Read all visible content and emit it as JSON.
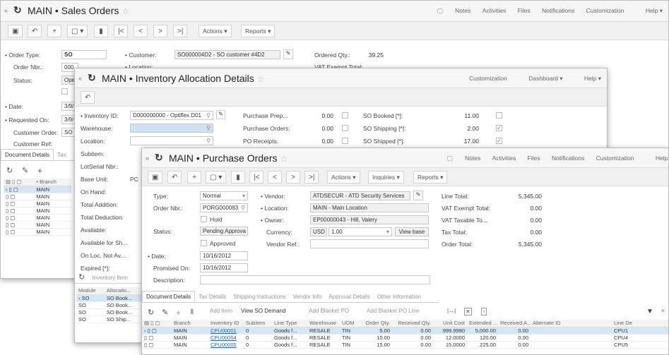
{
  "so": {
    "ref": "MAIN",
    "title": "Sales Orders",
    "header_links": [
      "Notes",
      "Activities",
      "Files",
      "Notifications",
      "Customization",
      "Help"
    ],
    "toolbar": {
      "actions": "Actions",
      "reports": "Reports"
    },
    "order_type_label": "• Order Type:",
    "order_type": "SO",
    "order_nbr_label": "Order Nbr.:",
    "order_nbr": "000",
    "status_label": "Status:",
    "status": "Ope",
    "date_label": "• Date:",
    "date": "3/9/",
    "requested_label": "• Requested On:",
    "requested": "3/9/",
    "customer_order_label": "Customer Order:",
    "customer_order": "SO",
    "customer_ref_label": "Customer Ref:",
    "customer_label": "• Customer:",
    "customer": "SO000004D2 - SO customer #4D2",
    "location_label": "• Location:",
    "ordered_qty_label": "Ordered Qty.:",
    "ordered_qty": "39.25",
    "vat_exempt_label": "VAT Exempt Total:",
    "tabs": [
      "Document Details",
      "Tax"
    ],
    "grid_header": "Branch",
    "grid_rows": [
      "MAIN",
      "MAIN",
      "MAIN",
      "MAIN",
      "MAIN",
      "MAIN",
      "MAIN"
    ]
  },
  "ia": {
    "ref": "MAIN",
    "title": "Inventory Allocation Details",
    "header_links": [
      "Customization",
      "Dashboard",
      "Help"
    ],
    "fields": [
      {
        "label": "• Inventory ID:",
        "value": "D000000000 - Optiflex D01"
      },
      {
        "label": "Warehouse:",
        "value": ""
      },
      {
        "label": "Location:",
        "value": ""
      },
      {
        "label": "Subitem:",
        "value": ""
      },
      {
        "label": "LotSerial Nbr.:",
        "value": ""
      },
      {
        "label": "Base Unit:",
        "value": "PC"
      },
      {
        "label": "On Hand:",
        "value": ""
      },
      {
        "label": "Total Addition:",
        "value": ""
      },
      {
        "label": "Total Deduction:",
        "value": ""
      },
      {
        "label": "Available:",
        "value": ""
      },
      {
        "label": "Available for Sh...",
        "value": ""
      },
      {
        "label": "On Loc. Not Av...",
        "value": ""
      },
      {
        "label": "Expired [*]:",
        "value": ""
      }
    ],
    "mid": [
      {
        "label": "Purchase Prep...",
        "value": "0.00"
      },
      {
        "label": "Purchase Orders:",
        "value": "0.00"
      },
      {
        "label": "PO Receipts:",
        "value": "0.00"
      }
    ],
    "right": [
      {
        "label": "SO Booked [*]:",
        "value": "11.00",
        "checked": false
      },
      {
        "label": "SO Shipping [*]:",
        "value": "2.00",
        "checked": true
      },
      {
        "label": "SO Shipped [*]:",
        "value": "17.00",
        "checked": true
      }
    ],
    "grid_tab": "Inventory Item",
    "grid_cols": [
      "Module",
      "Allocatio..."
    ],
    "grid_rows": [
      [
        "SO",
        "SO Book..."
      ],
      [
        "SO",
        "SO Book..."
      ],
      [
        "SO",
        "SO Book..."
      ],
      [
        "SO",
        "SO Ship..."
      ]
    ]
  },
  "po": {
    "ref": "MAIN",
    "title": "Purchase Orders",
    "header_links": [
      "Notes",
      "Activities",
      "Files",
      "Notifications",
      "Customization",
      "Help"
    ],
    "toolbar": {
      "actions": "Actions",
      "inquiries": "Inquiries",
      "reports": "Reports"
    },
    "type_label": "Type:",
    "type": "Normal",
    "order_nbr_label": "Order Nbr.:",
    "order_nbr": "PORG000083",
    "hold_label": "Hold",
    "status_label": "Status:",
    "status": "Pending Approva",
    "approved_label": "Approved",
    "date_label": "• Date:",
    "date": "10/16/2012",
    "promised_label": "Promised On:",
    "promised": "10/16/2012",
    "description_label": "Description:",
    "vendor_label": "• Vendor:",
    "vendor": "ATDSECUR - ATD Security Services",
    "location_label": "• Location:",
    "location": "MAIN - Main Location",
    "owner_label": "• Owner:",
    "owner": "EP00000043 - Hill, Valery",
    "currency_label": "Currency:",
    "currency": "USD",
    "rate": "1.00",
    "view_base": "View base",
    "vendor_ref_label": "Vendor Ref.:",
    "totals": [
      {
        "label": "Line Total:",
        "value": "5,345.00"
      },
      {
        "label": "VAT Exempt Total:",
        "value": "0.00"
      },
      {
        "label": "VAT Taxable To...",
        "value": "0.00"
      },
      {
        "label": "Tax Total:",
        "value": "0.00"
      },
      {
        "label": "Order Total:",
        "value": "5,345.00"
      }
    ],
    "tabs": [
      "Document Details",
      "Tax Details",
      "Shipping Instructions",
      "Vendor Info",
      "Approval Details",
      "Other Information"
    ],
    "grid_toolbar": {
      "add_item": "Add Item",
      "view_so": "View SO Demand",
      "add_blanket": "Add Blanket PO",
      "add_blanket_line": "Add Blanket PO Line"
    },
    "grid_cols": [
      "Branch",
      "Inventory ID",
      "Subitem",
      "Line Type",
      "Warehouse",
      "UOM",
      "Order Qty.",
      "Received Qty.",
      "Unit Cost",
      "Extended ...",
      "Received A...",
      "Alternate ID",
      "Line De"
    ],
    "grid_rows": [
      [
        "MAIN",
        "CPU00001",
        "0",
        "Goods f...",
        "RESALE",
        "TIN",
        "5.00",
        "0.00",
        "999.9990",
        "5,000.00",
        "0.00",
        "",
        "CPU1"
      ],
      [
        "MAIN",
        "CPU00004",
        "0",
        "Goods f...",
        "RESALE",
        "TIN",
        "10.00",
        "0.00",
        "12.0000",
        "120.00",
        "0.00",
        "",
        "CPU4"
      ],
      [
        "MAIN",
        "CPU00005",
        "0",
        "Goods f...",
        "RESALE",
        "TIN",
        "15.00",
        "0.00",
        "15.0000",
        "225.00",
        "0.00",
        "",
        "CPU5"
      ]
    ]
  }
}
